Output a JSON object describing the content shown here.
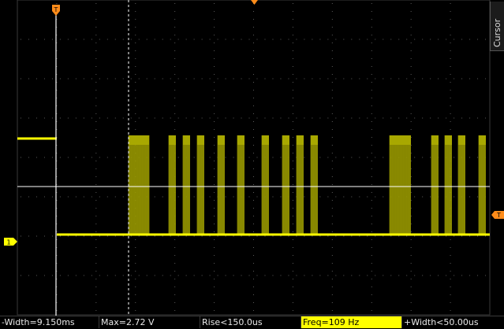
{
  "side_tab": {
    "label": "Cursor"
  },
  "channel": {
    "number": "1",
    "color": "#ffff00"
  },
  "measurements": [
    {
      "label": "-Width=9.150ms",
      "highlight": false
    },
    {
      "label": "Max=2.72 V",
      "highlight": false
    },
    {
      "label": "Rise<150.0us",
      "highlight": false
    },
    {
      "label": "Freq=109 Hz",
      "highlight": true
    },
    {
      "label": "+Width<50.00us",
      "highlight": false
    }
  ],
  "colors": {
    "background": "#000000",
    "grid": "#3a3a3a",
    "trace": "#ffff00",
    "trigger_marker": "#ff8c1a",
    "cursor_line": "#ffffff"
  }
}
